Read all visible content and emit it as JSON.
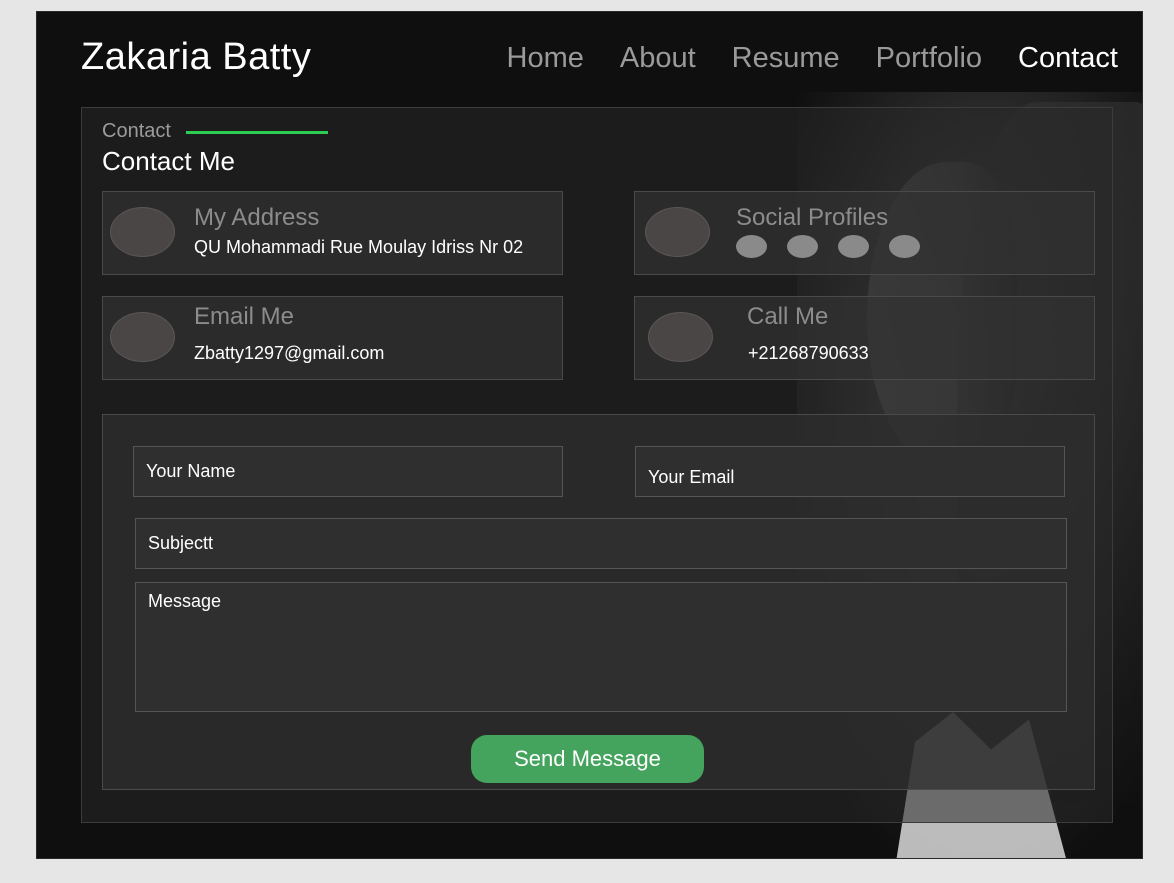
{
  "brand": "Zakaria Batty",
  "nav": {
    "items": [
      "Home",
      "About",
      "Resume",
      "Portfolio",
      "Contact"
    ],
    "active": "Contact"
  },
  "section": {
    "kicker": "Contact",
    "title": "Contact Me"
  },
  "cards": {
    "address": {
      "title": "My Address",
      "value": "QU Mohammadi Rue Moulay Idriss Nr 02"
    },
    "social": {
      "title": "Social Profiles",
      "icon_count": 4
    },
    "email": {
      "title": "Email Me",
      "value": "Zbatty1297@gmail.com"
    },
    "phone": {
      "title": "Call Me",
      "value": "+21268790633"
    }
  },
  "form": {
    "name_placeholder": "Your Name",
    "email_placeholder": "Your Email",
    "subject_placeholder": "Subjectt",
    "message_placeholder": "Message",
    "submit_label": "Send Message"
  },
  "colors": {
    "accent": "#2ecc52",
    "button": "#44a35c",
    "background": "#0f0f0f"
  }
}
